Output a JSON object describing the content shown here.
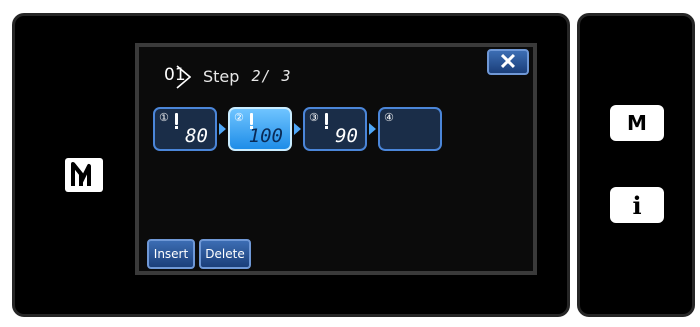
{
  "title": {
    "program_no": "01",
    "label": "Step",
    "page": "2/ 3"
  },
  "close_label": "✕",
  "steps": [
    {
      "circle": "①",
      "value": "80",
      "active": false
    },
    {
      "circle": "②",
      "value": "100",
      "active": true
    },
    {
      "circle": "③",
      "value": "90",
      "active": false
    },
    {
      "circle": "④",
      "value": "",
      "active": false
    }
  ],
  "buttons": {
    "insert_label": "Insert",
    "delete_label": "Delete"
  },
  "side": {
    "menu_label": "M",
    "info_label": "i"
  },
  "colors": {
    "button_blue": "#2a56a0",
    "active_step": "#39a7ff"
  }
}
